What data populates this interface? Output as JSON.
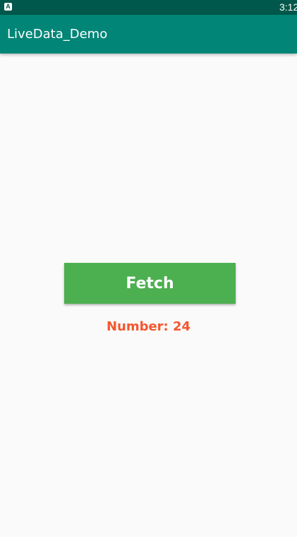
{
  "status_bar": {
    "notification_icon_glyph": "A",
    "time": "3:12"
  },
  "app_bar": {
    "title": "LiveData_Demo"
  },
  "main": {
    "fetch_button_label": "Fetch",
    "number_label": "Number: 24"
  },
  "colors": {
    "status_bar": "#00574b",
    "app_bar": "#008577",
    "button": "#4caf50",
    "number_text": "#f4572f",
    "background": "#fafafa"
  }
}
